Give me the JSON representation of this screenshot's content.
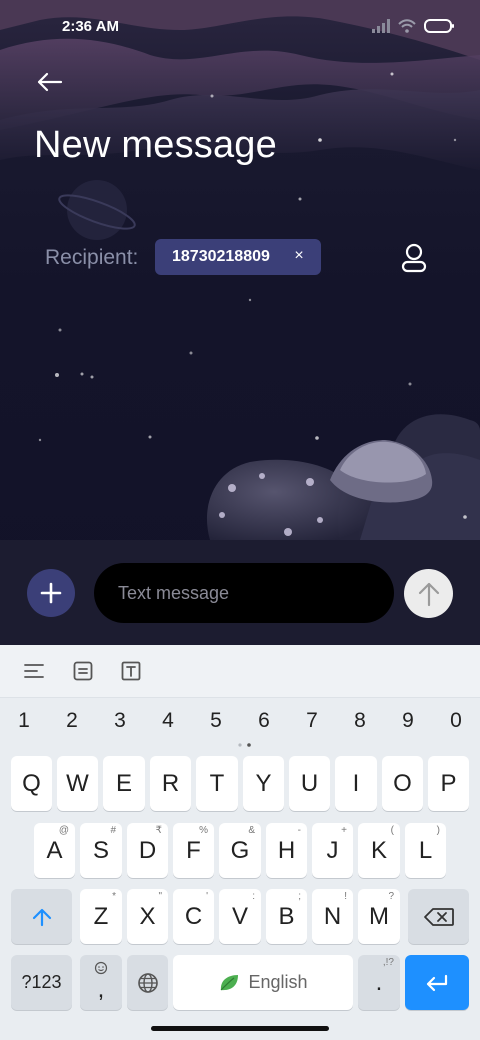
{
  "status_bar": {
    "time": "2:36 AM"
  },
  "header": {
    "title": "New message"
  },
  "recipient": {
    "label": "Recipient:",
    "chip_value": "18730218809",
    "chip_remove": "×"
  },
  "compose": {
    "placeholder": "Text message"
  },
  "keyboard": {
    "numbers": [
      "1",
      "2",
      "3",
      "4",
      "5",
      "6",
      "7",
      "8",
      "9",
      "0"
    ],
    "row1": [
      {
        "k": "Q",
        "h": ""
      },
      {
        "k": "W",
        "h": ""
      },
      {
        "k": "E",
        "h": ""
      },
      {
        "k": "R",
        "h": ""
      },
      {
        "k": "T",
        "h": ""
      },
      {
        "k": "Y",
        "h": ""
      },
      {
        "k": "U",
        "h": ""
      },
      {
        "k": "I",
        "h": ""
      },
      {
        "k": "O",
        "h": ""
      },
      {
        "k": "P",
        "h": ""
      }
    ],
    "row2": [
      {
        "k": "A",
        "h": "@"
      },
      {
        "k": "S",
        "h": "#"
      },
      {
        "k": "D",
        "h": "₹"
      },
      {
        "k": "F",
        "h": "%"
      },
      {
        "k": "G",
        "h": "&"
      },
      {
        "k": "H",
        "h": "-"
      },
      {
        "k": "J",
        "h": "+"
      },
      {
        "k": "K",
        "h": "("
      },
      {
        "k": "L",
        "h": ")"
      }
    ],
    "row3": [
      {
        "k": "Z",
        "h": "*"
      },
      {
        "k": "X",
        "h": "\""
      },
      {
        "k": "C",
        "h": "'"
      },
      {
        "k": "V",
        "h": ":"
      },
      {
        "k": "B",
        "h": ";"
      },
      {
        "k": "N",
        "h": "!"
      },
      {
        "k": "M",
        "h": "?"
      }
    ],
    "symbols_key": "?123",
    "comma_key": ",",
    "space_label": "English",
    "period_key": ".",
    "period_hint": ",!?"
  },
  "colors": {
    "accent": "#3b3f78",
    "enter_key": "#1e90ff",
    "keyboard_bg": "#e9edf1"
  }
}
